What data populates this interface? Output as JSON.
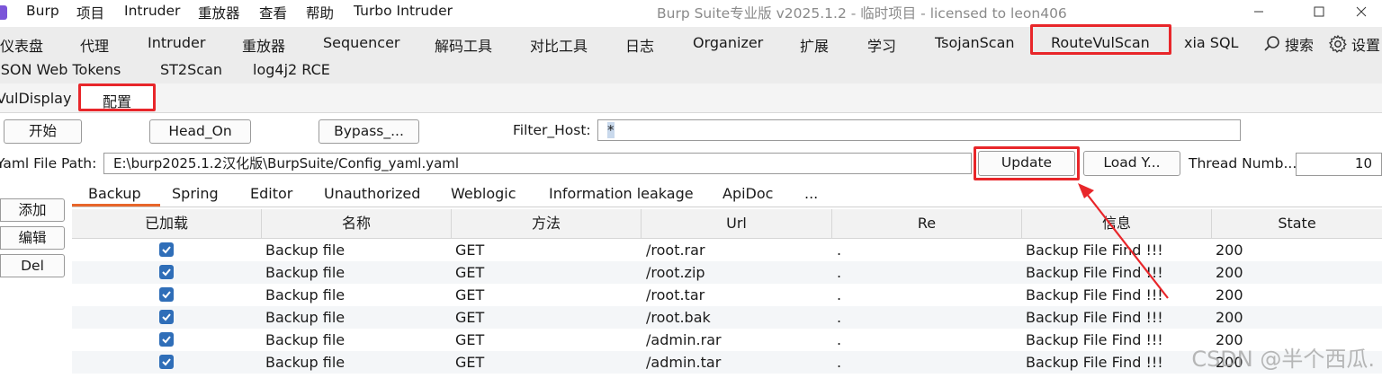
{
  "titlebar": {
    "menus": [
      "Burp",
      "项目",
      "Intruder",
      "重放器",
      "查看",
      "帮助",
      "Turbo Intruder"
    ],
    "title": "Burp Suite专业版  v2025.1.2 - 临时项目 - licensed to leon406"
  },
  "main_tabs": {
    "row1": [
      "仪表盘",
      "代理",
      "Intruder",
      "重放器",
      "Sequencer",
      "解码工具",
      "对比工具",
      "日志",
      "Organizer",
      "扩展",
      "学习",
      "TsojanScan",
      "RouteVulScan",
      "xia SQL"
    ],
    "search_label": "搜索",
    "settings_label": "设置",
    "row2": [
      "JSON Web Tokens",
      "ST2Scan",
      "log4j2 RCE"
    ],
    "highlighted": "RouteVulScan"
  },
  "sub_tabs": [
    "VulDisplay",
    "配置"
  ],
  "controls": {
    "start_button": "开始",
    "head_on_button": "Head_On",
    "bypass_button": "Bypass_...",
    "filter_host_label": "Filter_Host:",
    "filter_host_value": "*",
    "yaml_label": "Yaml File Path:",
    "yaml_value": "E:\\burp2025.1.2汉化版\\BurpSuite/Config_yaml.yaml",
    "update_button": "Update",
    "load_button": "Load Y...",
    "thread_label": "Thread Numb...",
    "thread_value": "10"
  },
  "side_buttons": [
    "添加",
    "编辑",
    "Del"
  ],
  "categories": [
    "Backup",
    "Spring",
    "Editor",
    "Unauthorized",
    "Weblogic",
    "Information leakage",
    "ApiDoc",
    "..."
  ],
  "selected_category": "Backup",
  "table": {
    "columns": [
      "已加载",
      "名称",
      "方法",
      "Url",
      "Re",
      "信息",
      "State"
    ],
    "rows": [
      {
        "loaded": true,
        "name": "Backup file",
        "method": "GET",
        "url": "/root.rar",
        "re": ".",
        "info": "Backup File Find !!!",
        "state": "200"
      },
      {
        "loaded": true,
        "name": "Backup file",
        "method": "GET",
        "url": "/root.zip",
        "re": ".",
        "info": "Backup File Find !!!",
        "state": "200"
      },
      {
        "loaded": true,
        "name": "Backup file",
        "method": "GET",
        "url": "/root.tar",
        "re": ".",
        "info": "Backup File Find !!!",
        "state": "200"
      },
      {
        "loaded": true,
        "name": "Backup file",
        "method": "GET",
        "url": "/root.bak",
        "re": ".",
        "info": "Backup File Find !!!",
        "state": "200"
      },
      {
        "loaded": true,
        "name": "Backup file",
        "method": "GET",
        "url": "/admin.rar",
        "re": ".",
        "info": "Backup File Find !!!",
        "state": "200"
      },
      {
        "loaded": true,
        "name": "Backup file",
        "method": "GET",
        "url": "/admin.tar",
        "re": ".",
        "info": "Backup File Find !!!",
        "state": "200"
      }
    ]
  },
  "watermark": "CSDN @半个西瓜.",
  "colors": {
    "highlight": "#e8262a",
    "accent": "#e8662a",
    "checkbox": "#2f6eb8",
    "logo": "#7b55d9"
  }
}
